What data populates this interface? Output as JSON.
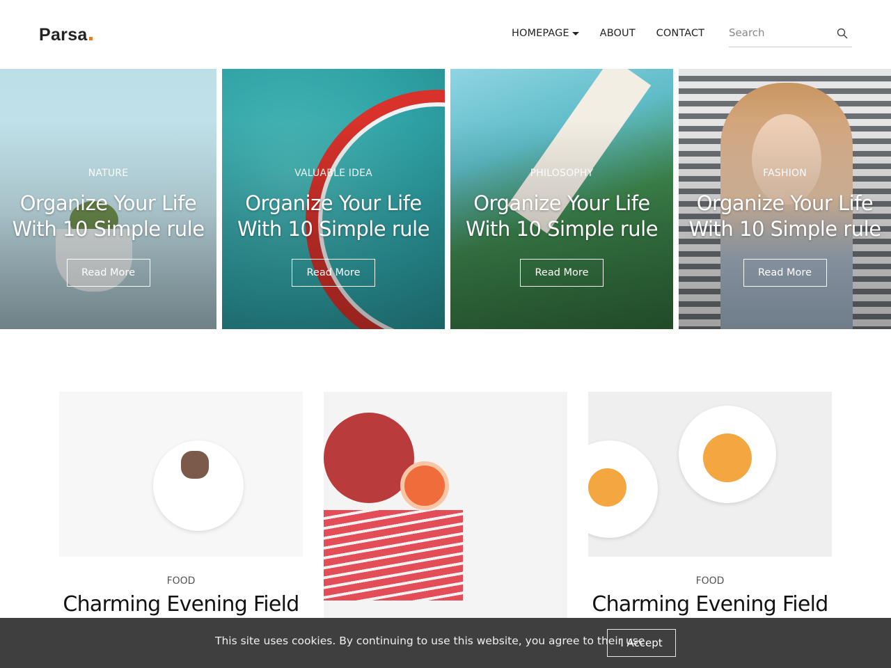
{
  "header": {
    "logo": "Parsa",
    "nav": [
      {
        "label": "HOMEPAGE",
        "has_dropdown": true
      },
      {
        "label": "ABOUT",
        "has_dropdown": false
      },
      {
        "label": "CONTACT",
        "has_dropdown": false
      }
    ],
    "search": {
      "placeholder": "Search",
      "icon": "search-icon"
    }
  },
  "hero": {
    "cards": [
      {
        "category": "NATURE",
        "title_line1": "Organize Your Life",
        "title_line2": "With 10 Simple rule",
        "button": "Read More"
      },
      {
        "category": "VALUABLE IDEA",
        "title_line1": "Organize Your Life",
        "title_line2": "With 10 Simple rule",
        "button": "Read More"
      },
      {
        "category": "PHILOSOPHY",
        "title_line1": "Organize Your Life",
        "title_line2": "With 10 Simple rule",
        "button": "Read More"
      },
      {
        "category": "FASHION",
        "title_line1": "Organize Your Life",
        "title_line2": "With 10 Simple rule",
        "button": "Read More"
      }
    ]
  },
  "posts": [
    {
      "category": "FOOD",
      "title": "Charming Evening Field"
    },
    {
      "category": "",
      "title": ""
    },
    {
      "category": "FOOD",
      "title": "Charming Evening Field"
    }
  ],
  "cookie": {
    "text": "This site uses cookies. By continuing to use this website, you agree to their use.",
    "button": "I Accept"
  },
  "colors": {
    "logo_dot": "#e67e22",
    "cookie_bar": "#3f3f3f",
    "text_dark": "#222222"
  }
}
